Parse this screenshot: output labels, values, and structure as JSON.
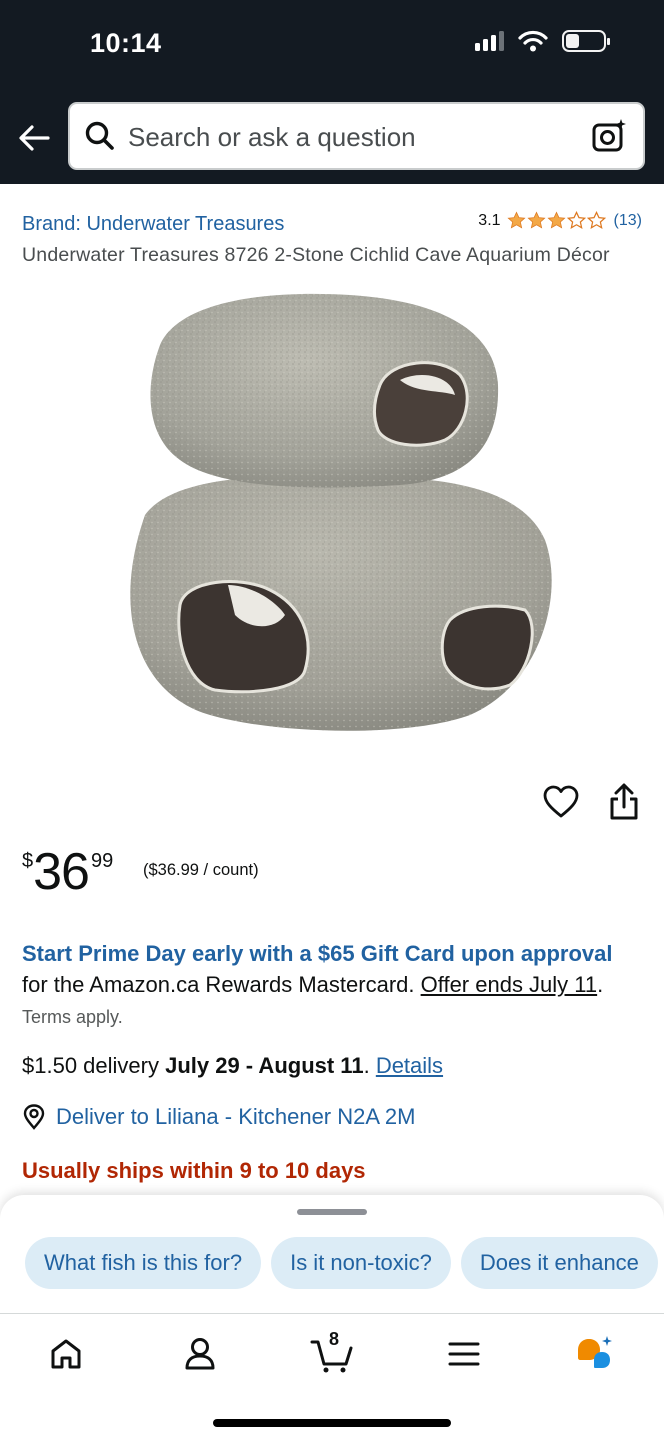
{
  "status_bar": {
    "time": "10:14"
  },
  "search": {
    "placeholder": "Search or ask a question"
  },
  "product": {
    "brand": "Brand: Underwater Treasures",
    "rating": "3.1",
    "rating_value": 3.1,
    "rating_count": "(13)",
    "title": "Underwater Treasures 8726 2-Stone Cichlid Cave Aquarium Décor"
  },
  "price": {
    "symbol": "$",
    "whole": "36",
    "fraction": "99",
    "per_unit": "($36.99 / count)"
  },
  "promo": {
    "bold": "Start Prime Day early with a $65 Gift Card upon approval",
    "text": " for the Amazon.ca Rewards Mastercard. ",
    "link": "Offer ends July 11",
    "period": ". ",
    "terms": "Terms apply."
  },
  "delivery": {
    "prefix": "$1.50 delivery ",
    "dates": "July 29 - August 11",
    "period": ". ",
    "link": "Details"
  },
  "deliver_to": "Deliver to Liliana - Kitchener N2A 2M",
  "ships": "Usually ships within 9 to 10 days",
  "suggestions": [
    "What fish is this for?",
    "Is it non-toxic?",
    "Does it enhance"
  ],
  "nav": {
    "cart_count": "8"
  },
  "colors": {
    "header_bg": "#131a22",
    "link": "#2162a1",
    "star": "#f3a847",
    "alert": "#b12704",
    "chip_bg": "#dcecf6"
  },
  "icons": [
    "back-arrow-icon",
    "search-icon",
    "camera-icon",
    "heart-icon",
    "share-icon",
    "location-icon",
    "home-icon",
    "account-icon",
    "cart-icon",
    "menu-icon",
    "rufus-icon"
  ]
}
